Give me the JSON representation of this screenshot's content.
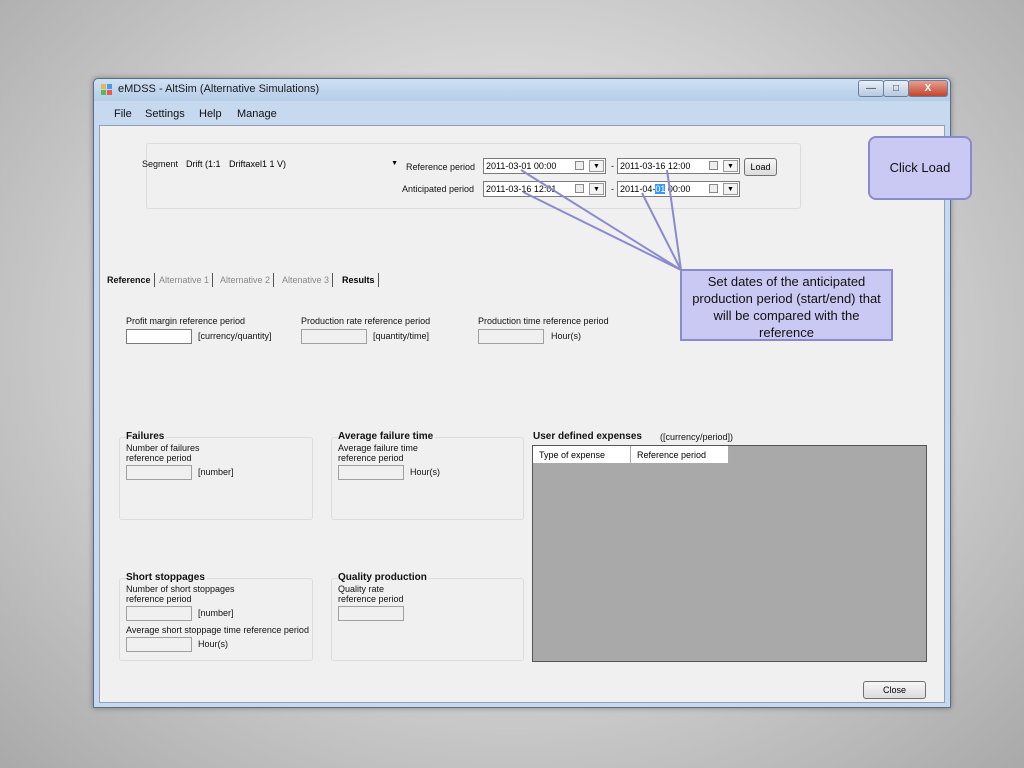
{
  "window": {
    "title": "eMDSS - AltSim (Alternative Simulations)",
    "min_glyph": "—",
    "max_glyph": "□",
    "close_glyph": "X"
  },
  "menu": [
    "File",
    "Settings",
    "Help",
    "Manage"
  ],
  "segment": {
    "label": "Segment",
    "value_code": "Drift (1:1",
    "value_name": "Driftaxel1 1 V)"
  },
  "reference_period": {
    "label": "Reference period",
    "start": "2011-03-01 00:00",
    "separator": "-",
    "end": "2011-03-16 12:00"
  },
  "anticipated_period": {
    "label": "Anticipated period",
    "start": "2011-03-16 12:01",
    "separator": "-",
    "end_prefix": "2011-04-",
    "end_highlight": "01",
    "end_suffix": " 00:00"
  },
  "load_button": "Load",
  "tabs": [
    "Reference",
    "Alternative 1",
    "Alternative 2",
    "Altenative 3",
    "Results"
  ],
  "active_tab": "Reference",
  "profit_margin": {
    "label": "Profit margin reference period",
    "unit": "[currency/quantity]"
  },
  "production_rate": {
    "label": "Production rate reference period",
    "unit": "[quantity/time]"
  },
  "production_time": {
    "label": "Production time reference period",
    "unit": "Hour(s)"
  },
  "failures": {
    "title": "Failures",
    "line1": "Number of failures",
    "line2": "reference period",
    "unit": "[number]"
  },
  "avg_failure": {
    "title": "Average failure time",
    "line1": "Average failure time",
    "line2": "reference period",
    "unit": "Hour(s)"
  },
  "user_expenses": {
    "title": "User defined expenses",
    "unit": "([currency/period])",
    "columns": [
      "Type of expense",
      "Reference period"
    ]
  },
  "short_stoppages": {
    "title": "Short stoppages",
    "line1": "Number of short stoppages",
    "line2": "reference period",
    "unit": "[number]",
    "avg_label": "Average short stoppage time reference period",
    "avg_unit": "Hour(s)"
  },
  "quality": {
    "title": "Quality production",
    "line1": "Quality rate",
    "line2": "reference period"
  },
  "close_button": "Close",
  "callouts": {
    "load": "Click Load",
    "dates": "Set dates of the anticipated production period (start/end) that will be compared with the reference"
  },
  "colors": {
    "title_bar": "#cfe0f3",
    "callout_fill": "#c9c9f4",
    "callout_border": "#8a8ad0",
    "selection": "#3399ff"
  }
}
